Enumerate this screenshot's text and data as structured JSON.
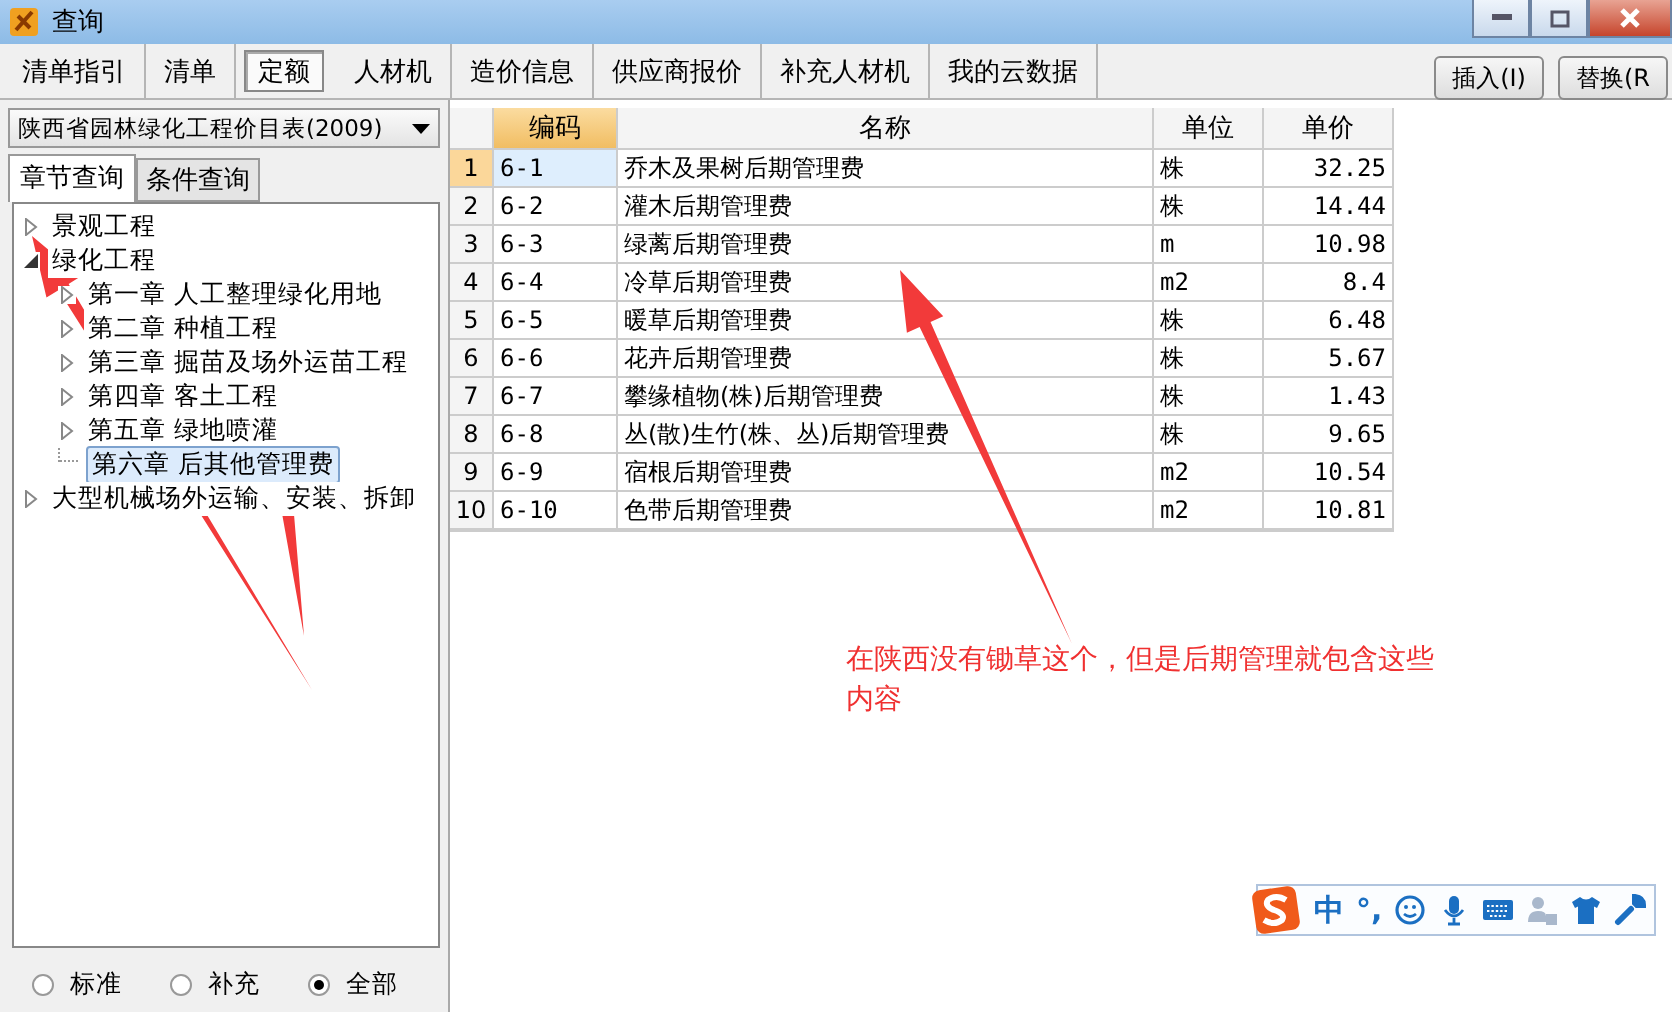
{
  "window": {
    "title": "查询"
  },
  "tabs": [
    {
      "label": "清单指引",
      "selected": false
    },
    {
      "label": "清单",
      "selected": false
    },
    {
      "label": "定额",
      "selected": true
    },
    {
      "label": "人材机",
      "selected": false
    },
    {
      "label": "造价信息",
      "selected": false
    },
    {
      "label": "供应商报价",
      "selected": false
    },
    {
      "label": "补充人材机",
      "selected": false
    },
    {
      "label": "我的云数据",
      "selected": false
    }
  ],
  "actions": [
    "插入(I)",
    "替换(R"
  ],
  "library": {
    "value": "陕西省园林绿化工程价目表(2009)"
  },
  "sub_tabs": [
    {
      "label": "章节查询",
      "selected": true
    },
    {
      "label": "条件查询",
      "selected": false
    }
  ],
  "tree": [
    {
      "label": "景观工程",
      "expanded": false,
      "selected": false
    },
    {
      "label": "绿化工程",
      "expanded": true,
      "selected": false,
      "children": [
        {
          "label": "第一章  人工整理绿化用地",
          "expanded": false,
          "selected": false
        },
        {
          "label": "第二章  种植工程",
          "expanded": false,
          "selected": false
        },
        {
          "label": "第三章  掘苗及场外运苗工程",
          "expanded": false,
          "selected": false
        },
        {
          "label": "第四章  客土工程",
          "expanded": false,
          "selected": false
        },
        {
          "label": "第五章  绿地喷灌",
          "expanded": false,
          "selected": false
        },
        {
          "label": "第六章  后其他管理费",
          "selected": true
        }
      ]
    },
    {
      "label": "大型机械场外运输、安装、拆卸",
      "expanded": false,
      "selected": false
    }
  ],
  "filters": [
    {
      "label": "标准",
      "selected": false
    },
    {
      "label": "补充",
      "selected": false
    },
    {
      "label": "全部",
      "selected": true
    }
  ],
  "table": {
    "columns": [
      "编码",
      "名称",
      "单位",
      "单价"
    ],
    "rows": [
      {
        "index": "1",
        "cells": [
          "6-1",
          "乔木及果树后期管理费",
          "株",
          "32.25"
        ],
        "selected": true
      },
      {
        "index": "2",
        "cells": [
          "6-2",
          "灌木后期管理费",
          "株",
          "14.44"
        ],
        "selected": false
      },
      {
        "index": "3",
        "cells": [
          "6-3",
          "绿蓠后期管理费",
          "m",
          "10.98"
        ],
        "selected": false
      },
      {
        "index": "4",
        "cells": [
          "6-4",
          "冷草后期管理费",
          "m2",
          "8.4"
        ],
        "selected": false
      },
      {
        "index": "5",
        "cells": [
          "6-5",
          "暖草后期管理费",
          "株",
          "6.48"
        ],
        "selected": false
      },
      {
        "index": "6",
        "cells": [
          "6-6",
          "花卉后期管理费",
          "株",
          "5.67"
        ],
        "selected": false
      },
      {
        "index": "7",
        "cells": [
          "6-7",
          "攀缘植物(株)后期管理费",
          "株",
          "1.43"
        ],
        "selected": false
      },
      {
        "index": "8",
        "cells": [
          "6-8",
          "丛(散)生竹(株、丛)后期管理费",
          "株",
          "9.65"
        ],
        "selected": false
      },
      {
        "index": "9",
        "cells": [
          "6-9",
          "宿根后期管理费",
          "m2",
          "10.54"
        ],
        "selected": false
      },
      {
        "index": "10",
        "cells": [
          "6-10",
          "色带后期管理费",
          "m2",
          "10.81"
        ],
        "selected": false
      }
    ]
  },
  "annotation": {
    "text": "在陕西没有锄草这个，但是后期管理就包含这些内容"
  },
  "ime_toolbar": {
    "mode": "中",
    "punctuation": "°,"
  }
}
